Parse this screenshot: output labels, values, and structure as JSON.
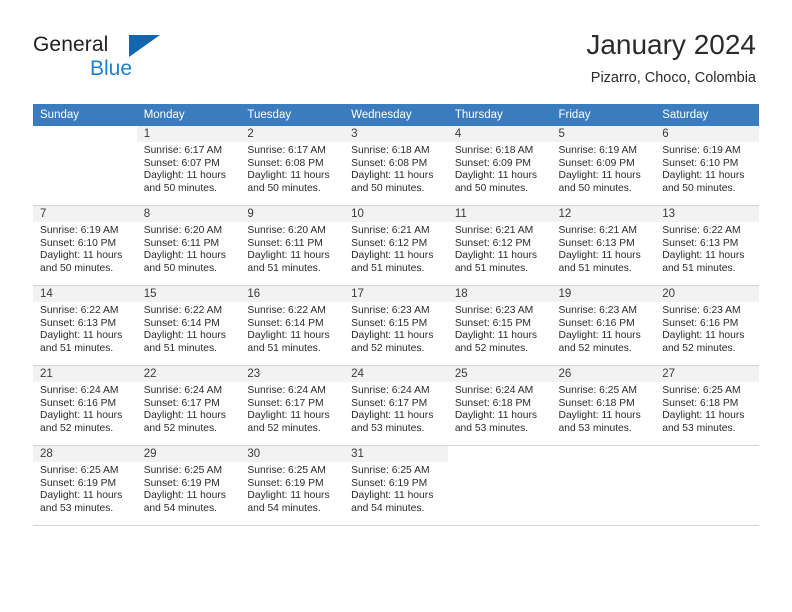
{
  "brand": {
    "name_part1": "General",
    "name_part2": "Blue",
    "logo_icon": "triangle-logo-icon",
    "accent_color": "#1266ad",
    "blue_text_color": "#1f7fd0"
  },
  "header": {
    "title": "January 2024",
    "location": "Pizarro, Choco, Colombia"
  },
  "calendar": {
    "header_bg": "#3a7cbe",
    "daynum_bg": "#f2f2f2",
    "weekday_headers": [
      "Sunday",
      "Monday",
      "Tuesday",
      "Wednesday",
      "Thursday",
      "Friday",
      "Saturday"
    ],
    "labels": {
      "sunrise_prefix": "Sunrise:",
      "sunset_prefix": "Sunset:",
      "daylight_prefix": "Daylight:"
    },
    "weeks": [
      [
        {
          "day": "",
          "sunrise": "",
          "sunset": "",
          "daylight_l1": "",
          "daylight_l2": ""
        },
        {
          "day": "1",
          "sunrise": "Sunrise: 6:17 AM",
          "sunset": "Sunset: 6:07 PM",
          "daylight_l1": "Daylight: 11 hours",
          "daylight_l2": "and 50 minutes."
        },
        {
          "day": "2",
          "sunrise": "Sunrise: 6:17 AM",
          "sunset": "Sunset: 6:08 PM",
          "daylight_l1": "Daylight: 11 hours",
          "daylight_l2": "and 50 minutes."
        },
        {
          "day": "3",
          "sunrise": "Sunrise: 6:18 AM",
          "sunset": "Sunset: 6:08 PM",
          "daylight_l1": "Daylight: 11 hours",
          "daylight_l2": "and 50 minutes."
        },
        {
          "day": "4",
          "sunrise": "Sunrise: 6:18 AM",
          "sunset": "Sunset: 6:09 PM",
          "daylight_l1": "Daylight: 11 hours",
          "daylight_l2": "and 50 minutes."
        },
        {
          "day": "5",
          "sunrise": "Sunrise: 6:19 AM",
          "sunset": "Sunset: 6:09 PM",
          "daylight_l1": "Daylight: 11 hours",
          "daylight_l2": "and 50 minutes."
        },
        {
          "day": "6",
          "sunrise": "Sunrise: 6:19 AM",
          "sunset": "Sunset: 6:10 PM",
          "daylight_l1": "Daylight: 11 hours",
          "daylight_l2": "and 50 minutes."
        }
      ],
      [
        {
          "day": "7",
          "sunrise": "Sunrise: 6:19 AM",
          "sunset": "Sunset: 6:10 PM",
          "daylight_l1": "Daylight: 11 hours",
          "daylight_l2": "and 50 minutes."
        },
        {
          "day": "8",
          "sunrise": "Sunrise: 6:20 AM",
          "sunset": "Sunset: 6:11 PM",
          "daylight_l1": "Daylight: 11 hours",
          "daylight_l2": "and 50 minutes."
        },
        {
          "day": "9",
          "sunrise": "Sunrise: 6:20 AM",
          "sunset": "Sunset: 6:11 PM",
          "daylight_l1": "Daylight: 11 hours",
          "daylight_l2": "and 51 minutes."
        },
        {
          "day": "10",
          "sunrise": "Sunrise: 6:21 AM",
          "sunset": "Sunset: 6:12 PM",
          "daylight_l1": "Daylight: 11 hours",
          "daylight_l2": "and 51 minutes."
        },
        {
          "day": "11",
          "sunrise": "Sunrise: 6:21 AM",
          "sunset": "Sunset: 6:12 PM",
          "daylight_l1": "Daylight: 11 hours",
          "daylight_l2": "and 51 minutes."
        },
        {
          "day": "12",
          "sunrise": "Sunrise: 6:21 AM",
          "sunset": "Sunset: 6:13 PM",
          "daylight_l1": "Daylight: 11 hours",
          "daylight_l2": "and 51 minutes."
        },
        {
          "day": "13",
          "sunrise": "Sunrise: 6:22 AM",
          "sunset": "Sunset: 6:13 PM",
          "daylight_l1": "Daylight: 11 hours",
          "daylight_l2": "and 51 minutes."
        }
      ],
      [
        {
          "day": "14",
          "sunrise": "Sunrise: 6:22 AM",
          "sunset": "Sunset: 6:13 PM",
          "daylight_l1": "Daylight: 11 hours",
          "daylight_l2": "and 51 minutes."
        },
        {
          "day": "15",
          "sunrise": "Sunrise: 6:22 AM",
          "sunset": "Sunset: 6:14 PM",
          "daylight_l1": "Daylight: 11 hours",
          "daylight_l2": "and 51 minutes."
        },
        {
          "day": "16",
          "sunrise": "Sunrise: 6:22 AM",
          "sunset": "Sunset: 6:14 PM",
          "daylight_l1": "Daylight: 11 hours",
          "daylight_l2": "and 51 minutes."
        },
        {
          "day": "17",
          "sunrise": "Sunrise: 6:23 AM",
          "sunset": "Sunset: 6:15 PM",
          "daylight_l1": "Daylight: 11 hours",
          "daylight_l2": "and 52 minutes."
        },
        {
          "day": "18",
          "sunrise": "Sunrise: 6:23 AM",
          "sunset": "Sunset: 6:15 PM",
          "daylight_l1": "Daylight: 11 hours",
          "daylight_l2": "and 52 minutes."
        },
        {
          "day": "19",
          "sunrise": "Sunrise: 6:23 AM",
          "sunset": "Sunset: 6:16 PM",
          "daylight_l1": "Daylight: 11 hours",
          "daylight_l2": "and 52 minutes."
        },
        {
          "day": "20",
          "sunrise": "Sunrise: 6:23 AM",
          "sunset": "Sunset: 6:16 PM",
          "daylight_l1": "Daylight: 11 hours",
          "daylight_l2": "and 52 minutes."
        }
      ],
      [
        {
          "day": "21",
          "sunrise": "Sunrise: 6:24 AM",
          "sunset": "Sunset: 6:16 PM",
          "daylight_l1": "Daylight: 11 hours",
          "daylight_l2": "and 52 minutes."
        },
        {
          "day": "22",
          "sunrise": "Sunrise: 6:24 AM",
          "sunset": "Sunset: 6:17 PM",
          "daylight_l1": "Daylight: 11 hours",
          "daylight_l2": "and 52 minutes."
        },
        {
          "day": "23",
          "sunrise": "Sunrise: 6:24 AM",
          "sunset": "Sunset: 6:17 PM",
          "daylight_l1": "Daylight: 11 hours",
          "daylight_l2": "and 52 minutes."
        },
        {
          "day": "24",
          "sunrise": "Sunrise: 6:24 AM",
          "sunset": "Sunset: 6:17 PM",
          "daylight_l1": "Daylight: 11 hours",
          "daylight_l2": "and 53 minutes."
        },
        {
          "day": "25",
          "sunrise": "Sunrise: 6:24 AM",
          "sunset": "Sunset: 6:18 PM",
          "daylight_l1": "Daylight: 11 hours",
          "daylight_l2": "and 53 minutes."
        },
        {
          "day": "26",
          "sunrise": "Sunrise: 6:25 AM",
          "sunset": "Sunset: 6:18 PM",
          "daylight_l1": "Daylight: 11 hours",
          "daylight_l2": "and 53 minutes."
        },
        {
          "day": "27",
          "sunrise": "Sunrise: 6:25 AM",
          "sunset": "Sunset: 6:18 PM",
          "daylight_l1": "Daylight: 11 hours",
          "daylight_l2": "and 53 minutes."
        }
      ],
      [
        {
          "day": "28",
          "sunrise": "Sunrise: 6:25 AM",
          "sunset": "Sunset: 6:19 PM",
          "daylight_l1": "Daylight: 11 hours",
          "daylight_l2": "and 53 minutes."
        },
        {
          "day": "29",
          "sunrise": "Sunrise: 6:25 AM",
          "sunset": "Sunset: 6:19 PM",
          "daylight_l1": "Daylight: 11 hours",
          "daylight_l2": "and 54 minutes."
        },
        {
          "day": "30",
          "sunrise": "Sunrise: 6:25 AM",
          "sunset": "Sunset: 6:19 PM",
          "daylight_l1": "Daylight: 11 hours",
          "daylight_l2": "and 54 minutes."
        },
        {
          "day": "31",
          "sunrise": "Sunrise: 6:25 AM",
          "sunset": "Sunset: 6:19 PM",
          "daylight_l1": "Daylight: 11 hours",
          "daylight_l2": "and 54 minutes."
        },
        {
          "day": "",
          "sunrise": "",
          "sunset": "",
          "daylight_l1": "",
          "daylight_l2": ""
        },
        {
          "day": "",
          "sunrise": "",
          "sunset": "",
          "daylight_l1": "",
          "daylight_l2": ""
        },
        {
          "day": "",
          "sunrise": "",
          "sunset": "",
          "daylight_l1": "",
          "daylight_l2": ""
        }
      ]
    ]
  }
}
